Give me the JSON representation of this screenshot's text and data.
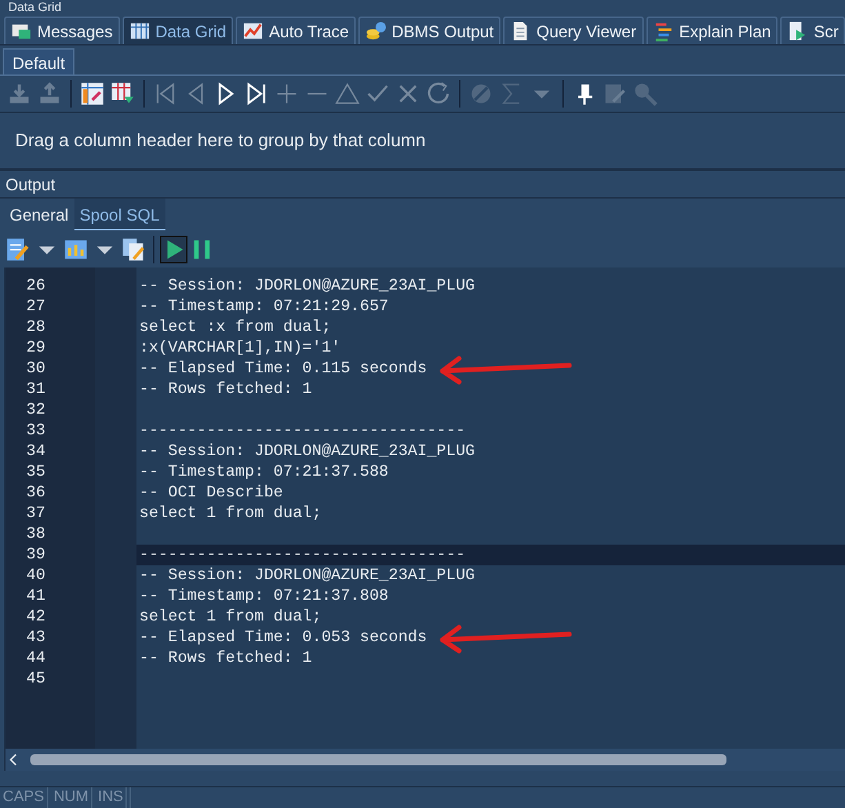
{
  "panel_title": "Data Grid",
  "tabs": [
    {
      "label": "Messages",
      "selected": false
    },
    {
      "label": "Data Grid",
      "selected": true
    },
    {
      "label": "Auto Trace",
      "selected": false
    },
    {
      "label": "DBMS Output",
      "selected": false
    },
    {
      "label": "Query Viewer",
      "selected": false
    },
    {
      "label": "Explain Plan",
      "selected": false
    },
    {
      "label": "Scr",
      "selected": false
    }
  ],
  "subtabs": [
    {
      "label": "Default",
      "selected": true
    }
  ],
  "grid_toolbar": [
    {
      "kind": "download",
      "disabled": true
    },
    {
      "kind": "upload",
      "disabled": true
    },
    {
      "kind": "sep"
    },
    {
      "kind": "grid-a",
      "disabled": false
    },
    {
      "kind": "grid-b",
      "disabled": false
    },
    {
      "kind": "sep"
    },
    {
      "kind": "first",
      "disabled": true
    },
    {
      "kind": "prev",
      "disabled": true
    },
    {
      "kind": "next",
      "disabled": false
    },
    {
      "kind": "last",
      "disabled": false
    },
    {
      "kind": "plus",
      "disabled": true
    },
    {
      "kind": "minus",
      "disabled": true
    },
    {
      "kind": "triangle",
      "disabled": true
    },
    {
      "kind": "check",
      "disabled": true
    },
    {
      "kind": "cross",
      "disabled": true
    },
    {
      "kind": "refresh",
      "disabled": true
    },
    {
      "kind": "sep"
    },
    {
      "kind": "eraser",
      "disabled": true
    },
    {
      "kind": "sigma",
      "disabled": true
    },
    {
      "kind": "caret",
      "disabled": true
    },
    {
      "kind": "sep"
    },
    {
      "kind": "pin",
      "disabled": false
    },
    {
      "kind": "edit",
      "disabled": true
    },
    {
      "kind": "search",
      "disabled": true
    }
  ],
  "group_hint": "Drag a column header here to group by that column",
  "output": {
    "title": "Output",
    "tabs": [
      {
        "label": "General",
        "selected": false
      },
      {
        "label": "Spool SQL",
        "selected": true
      }
    ],
    "toolbar": [
      {
        "kind": "edit-doc"
      },
      {
        "kind": "caret"
      },
      {
        "kind": "chart"
      },
      {
        "kind": "caret"
      },
      {
        "kind": "copy-doc"
      },
      {
        "kind": "sep"
      },
      {
        "kind": "play",
        "pressed": true
      },
      {
        "kind": "pause",
        "pressed": false
      }
    ],
    "lines": [
      {
        "number": "26",
        "text": "-- Session: JDORLON@AZURE_23AI_PLUG",
        "current": false,
        "arrow": false
      },
      {
        "number": "27",
        "text": "-- Timestamp: 07:21:29.657",
        "current": false,
        "arrow": false
      },
      {
        "number": "28",
        "text": "select :x from dual;",
        "current": false,
        "arrow": false
      },
      {
        "number": "29",
        "text": ":x(VARCHAR[1],IN)='1'",
        "current": false,
        "arrow": false
      },
      {
        "number": "30",
        "text": "-- Elapsed Time: 0.115 seconds",
        "current": false,
        "arrow": true
      },
      {
        "number": "31",
        "text": "-- Rows fetched: 1",
        "current": false,
        "arrow": false
      },
      {
        "number": "32",
        "current": false,
        "arrow": false
      },
      {
        "number": "33",
        "text": "----------------------------------",
        "current": false,
        "arrow": false
      },
      {
        "number": "34",
        "text": "-- Session: JDORLON@AZURE_23AI_PLUG",
        "current": false,
        "arrow": false
      },
      {
        "number": "35",
        "text": "-- Timestamp: 07:21:37.588",
        "current": false,
        "arrow": false
      },
      {
        "number": "36",
        "text": "-- OCI Describe",
        "current": false,
        "arrow": false
      },
      {
        "number": "37",
        "text": "select 1 from dual;",
        "current": false,
        "arrow": false
      },
      {
        "number": "38",
        "current": false,
        "arrow": false
      },
      {
        "number": "39",
        "text": "----------------------------------",
        "current": true,
        "arrow": false
      },
      {
        "number": "40",
        "text": "-- Session: JDORLON@AZURE_23AI_PLUG",
        "current": false,
        "arrow": false
      },
      {
        "number": "41",
        "text": "-- Timestamp: 07:21:37.808",
        "current": false,
        "arrow": false
      },
      {
        "number": "42",
        "text": "select 1 from dual;",
        "current": false,
        "arrow": false
      },
      {
        "number": "43",
        "text": "-- Elapsed Time: 0.053 seconds",
        "current": false,
        "arrow": true
      },
      {
        "number": "44",
        "text": "-- Rows fetched: 1",
        "current": false,
        "arrow": false
      },
      {
        "number": "45",
        "current": false,
        "arrow": false
      }
    ]
  },
  "status_bar": [
    {
      "label": "CAPS",
      "on": false
    },
    {
      "label": "NUM",
      "on": false
    },
    {
      "label": "INS",
      "on": false
    }
  ]
}
